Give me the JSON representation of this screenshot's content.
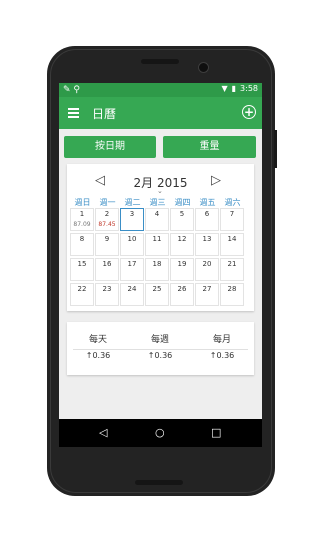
{
  "status_bar": {
    "left_icons": "✎ ⚲",
    "time": "3:58"
  },
  "app_bar": {
    "title": "日曆",
    "menu_icon": "menu-icon",
    "add_icon": "add-circle-icon",
    "add_glyph": "+"
  },
  "buttons": {
    "by_date": "按日期",
    "weight": "重量"
  },
  "calendar": {
    "month_label": "2月 2015",
    "prev": "◁",
    "next": "▷",
    "chevron": "⌄",
    "weekdays": [
      "週日",
      "週一",
      "週二",
      "週三",
      "週四",
      "週五",
      "週六"
    ],
    "weeks": [
      [
        {
          "d": "1",
          "v": "87.09"
        },
        {
          "d": "2",
          "v": "87.45",
          "red": true
        },
        {
          "d": "3",
          "v": "",
          "sel": true
        },
        {
          "d": "4",
          "v": ""
        },
        {
          "d": "5",
          "v": ""
        },
        {
          "d": "6",
          "v": ""
        },
        {
          "d": "7",
          "v": ""
        }
      ],
      [
        {
          "d": "8",
          "v": ""
        },
        {
          "d": "9",
          "v": ""
        },
        {
          "d": "10",
          "v": ""
        },
        {
          "d": "11",
          "v": ""
        },
        {
          "d": "12",
          "v": ""
        },
        {
          "d": "13",
          "v": ""
        },
        {
          "d": "14",
          "v": ""
        }
      ],
      [
        {
          "d": "15",
          "v": ""
        },
        {
          "d": "16",
          "v": ""
        },
        {
          "d": "17",
          "v": ""
        },
        {
          "d": "18",
          "v": ""
        },
        {
          "d": "19",
          "v": ""
        },
        {
          "d": "20",
          "v": ""
        },
        {
          "d": "21",
          "v": ""
        }
      ],
      [
        {
          "d": "22",
          "v": ""
        },
        {
          "d": "23",
          "v": ""
        },
        {
          "d": "24",
          "v": ""
        },
        {
          "d": "25",
          "v": ""
        },
        {
          "d": "26",
          "v": ""
        },
        {
          "d": "27",
          "v": ""
        },
        {
          "d": "28",
          "v": ""
        }
      ]
    ]
  },
  "stats": [
    {
      "label": "每天",
      "value": "↑0.36"
    },
    {
      "label": "每週",
      "value": "↑0.36"
    },
    {
      "label": "每月",
      "value": "↑0.36"
    }
  ],
  "nav": {
    "back": "◁",
    "home": "○",
    "recent": "□"
  }
}
